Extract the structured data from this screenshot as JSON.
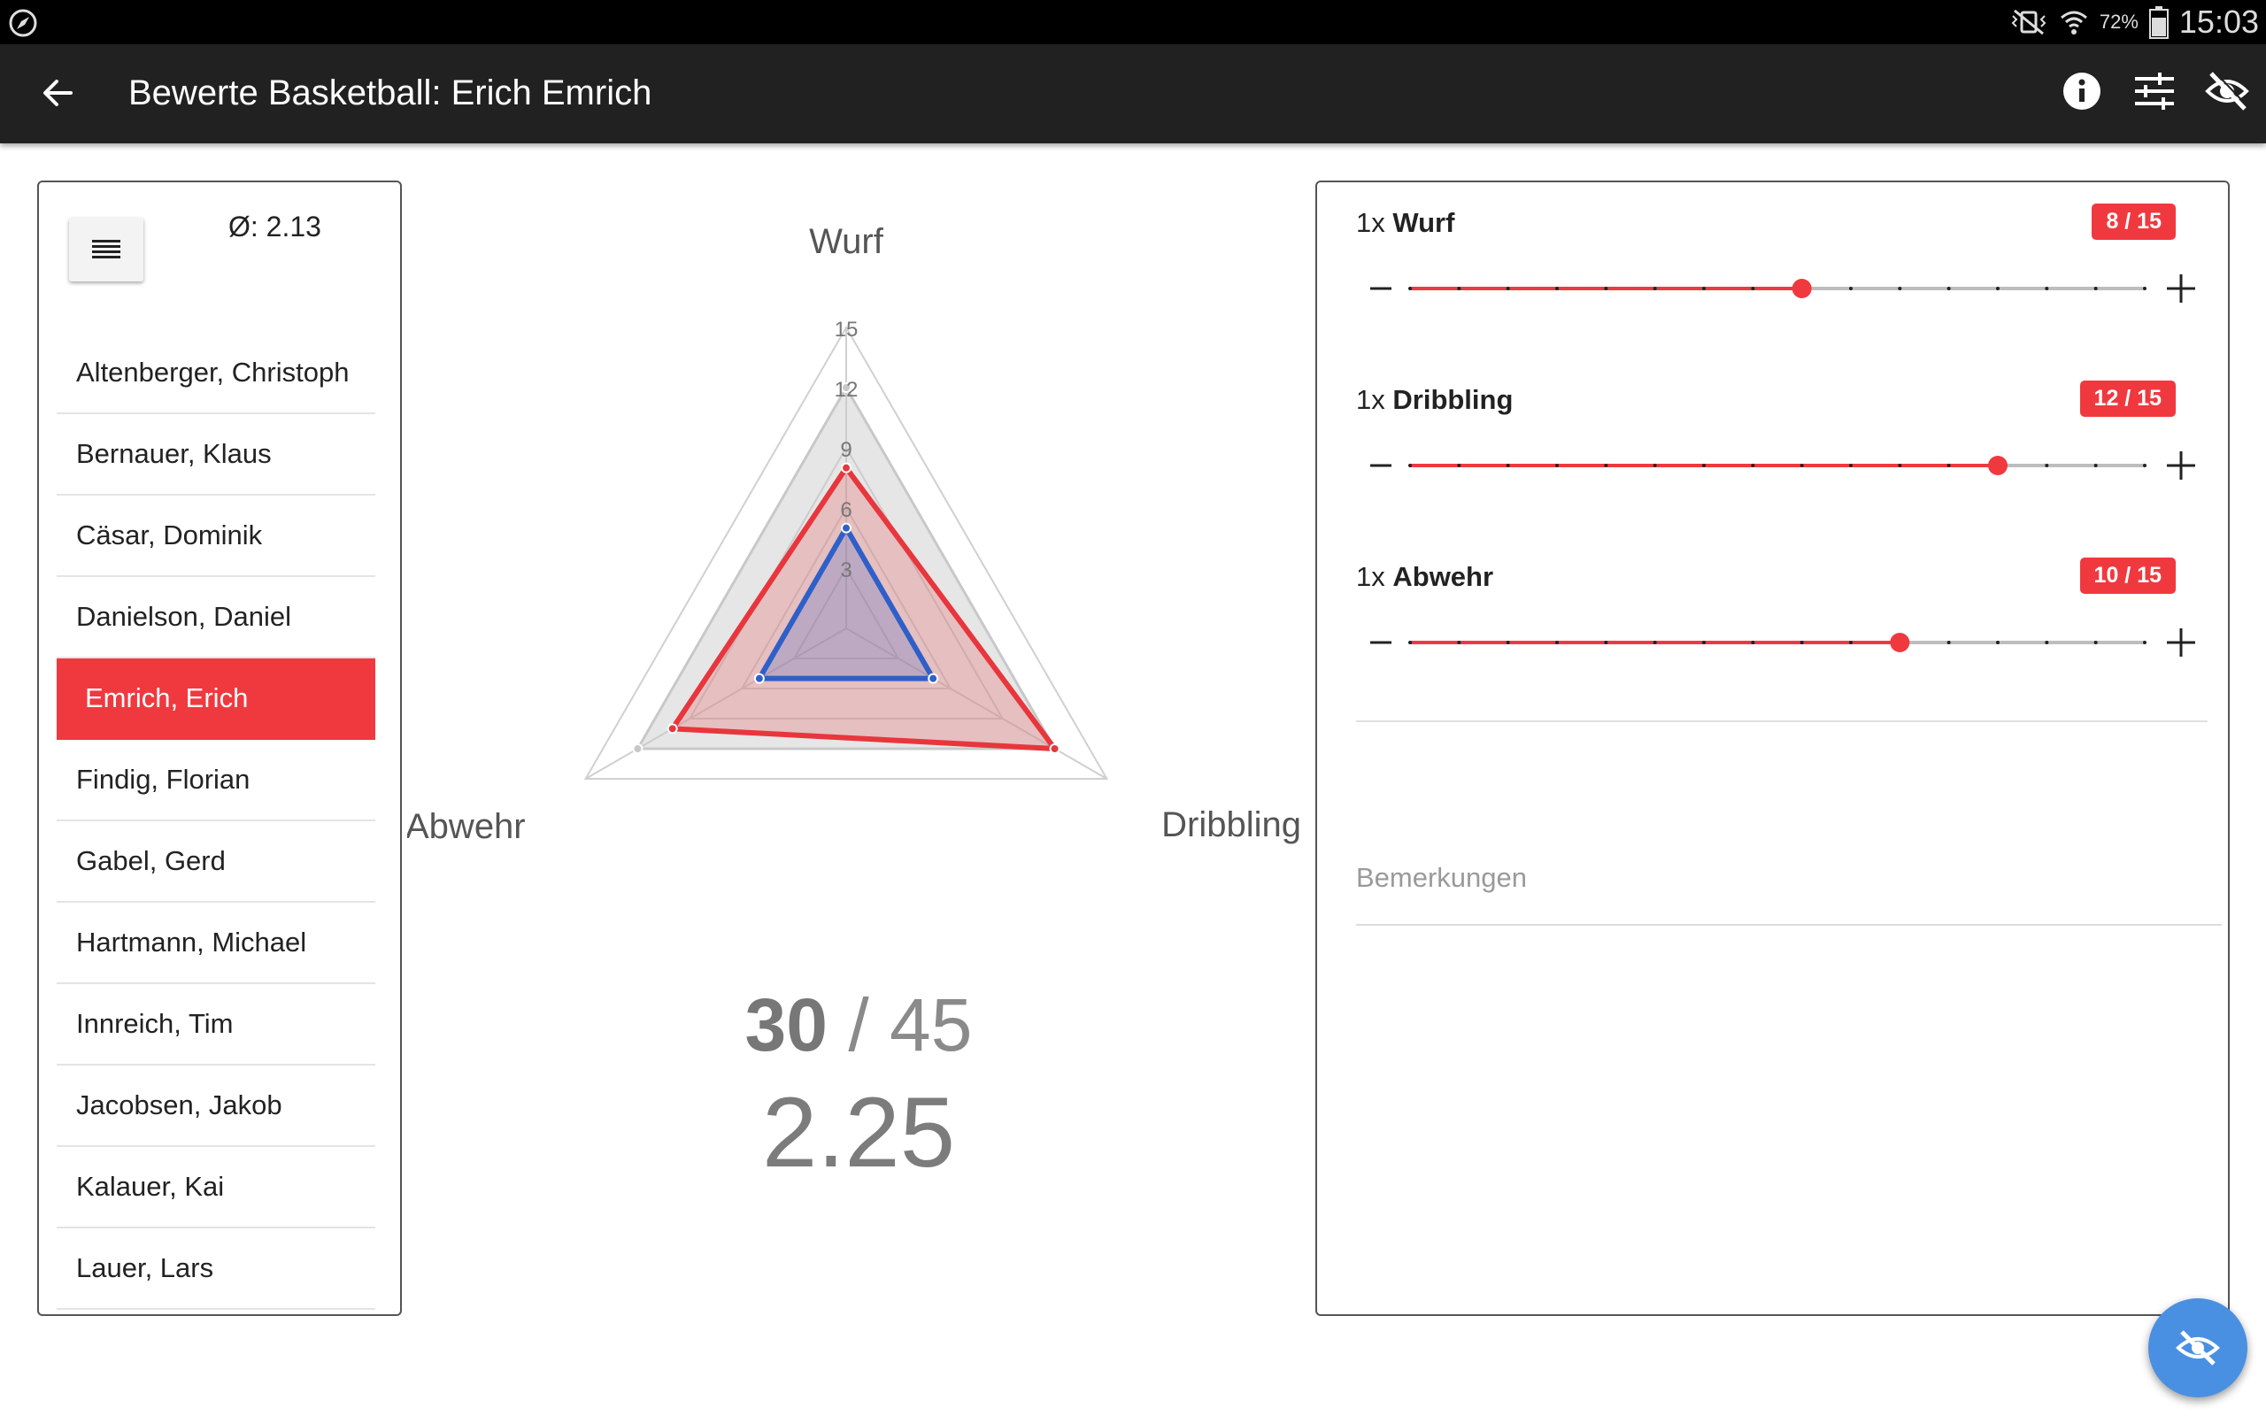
{
  "status_bar": {
    "battery_percent": "72%",
    "time": "15:03",
    "icons": [
      "compass-icon",
      "vibrate-mute-icon",
      "wifi-icon",
      "battery-icon"
    ]
  },
  "app_bar": {
    "title": "Bewerte Basketball: Erich Emrich",
    "icons": [
      "back-arrow-icon",
      "info-icon",
      "tune-icon",
      "visibility-off-icon"
    ]
  },
  "list": {
    "average": "Ø: 2.13",
    "active_index": 4,
    "players": [
      "Altenberger, Christoph",
      "Bernauer, Klaus",
      "Cäsar, Dominik",
      "Danielson, Daniel",
      "Emrich, Erich",
      "Findig, Florian",
      "Gabel, Gerd",
      "Hartmann, Michael",
      "Innreich, Tim",
      "Jacobsen, Jakob",
      "Kalauer, Kai",
      "Lauer, Lars"
    ]
  },
  "chart_data": {
    "type": "radar",
    "axes": [
      "Wurf",
      "Dribbling",
      "Abwehr"
    ],
    "ticks": [
      "3",
      "6",
      "9",
      "12",
      "15"
    ],
    "rmax": 15,
    "series": [
      {
        "values": [
          12,
          12,
          12
        ],
        "color": "#c8c8c8"
      },
      {
        "values": [
          8,
          12,
          10
        ],
        "color": "#e8363d"
      },
      {
        "values": [
          5,
          5,
          5
        ],
        "color": "#2f5fc8"
      }
    ],
    "colors": {
      "grid": "#d0d0d0",
      "label": "#555555"
    }
  },
  "score": {
    "achieved": "30",
    "max": "45",
    "grade": "2.25"
  },
  "criteria": [
    {
      "prefix": "1x",
      "name": "Wurf",
      "badge": "8 / 15",
      "value": 8,
      "max": 15
    },
    {
      "prefix": "1x",
      "name": "Dribbling",
      "badge": "12 / 15",
      "value": 12,
      "max": 15
    },
    {
      "prefix": "1x",
      "name": "Abwehr",
      "badge": "10 / 15",
      "value": 10,
      "max": 15
    }
  ],
  "remarks": {
    "placeholder": "Bemerkungen",
    "value": ""
  },
  "fab": {
    "icon": "visibility-off-icon"
  },
  "colors": {
    "accent": "#f0393f",
    "fab": "#4a90e2",
    "appbar": "#212121"
  }
}
